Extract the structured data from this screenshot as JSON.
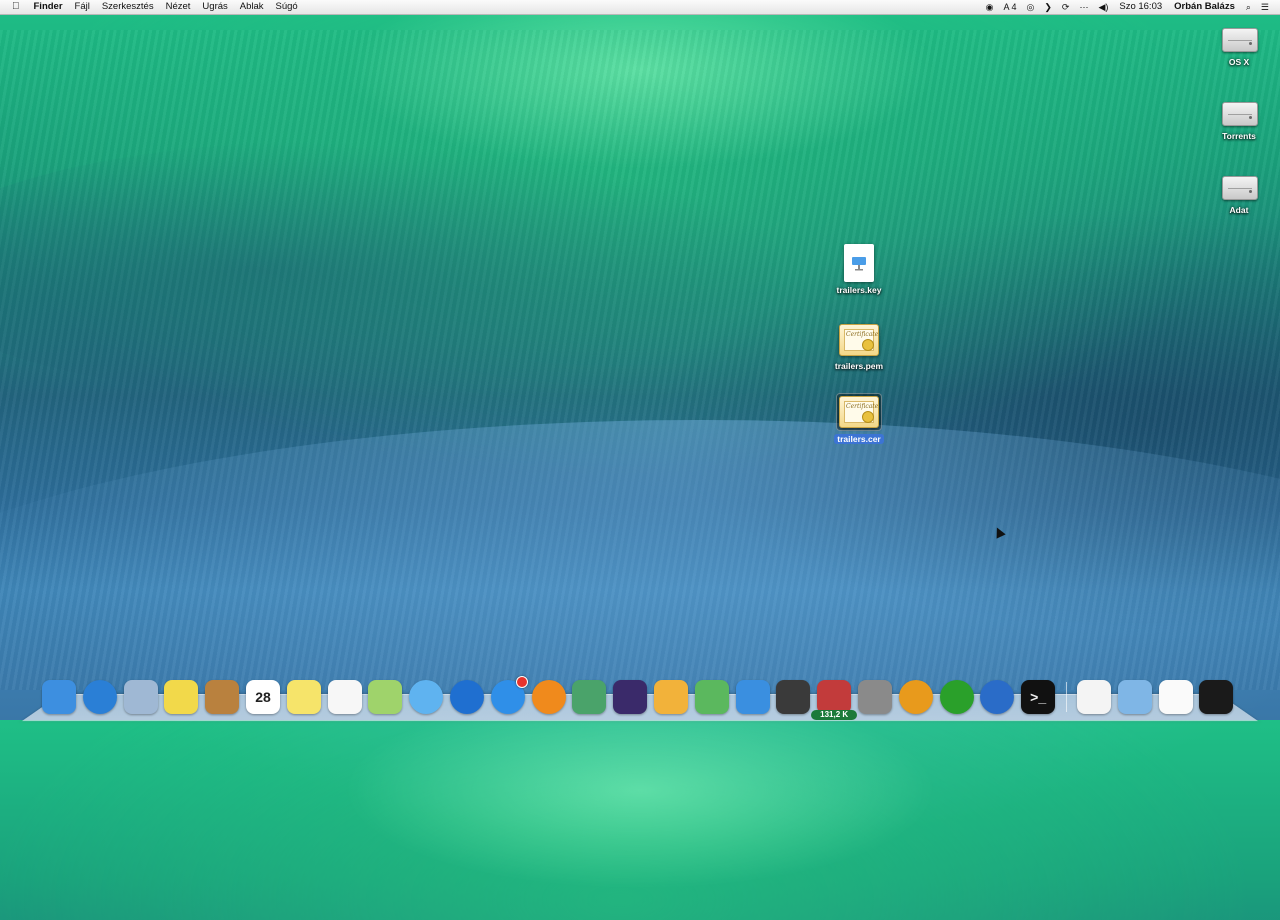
{
  "menubar": {
    "apple": "",
    "app_name": "Finder",
    "menus": [
      "Fájl",
      "Szerkesztés",
      "Nézet",
      "Ugrás",
      "Ablak",
      "Súgó"
    ],
    "status": {
      "record_icon": "◉",
      "display_icon": "A",
      "display_count": "4",
      "headphones_icon": "◎",
      "nav_icon": "❯",
      "sync_icon": "⟳",
      "dots_icon": "⋯",
      "volume_icon": "◀)",
      "clock": "Szo 16:03",
      "user": "Orbán Balázs",
      "search_icon": "⌕",
      "list_icon": "☰"
    }
  },
  "drives": [
    {
      "name": "OS X"
    },
    {
      "name": "Torrents"
    },
    {
      "name": "Adat"
    }
  ],
  "files": [
    {
      "name": "trailers.key",
      "kind": "keynote"
    },
    {
      "name": "trailers.pem",
      "kind": "certificate"
    },
    {
      "name": "trailers.cer",
      "kind": "certificate",
      "selected": true
    }
  ],
  "cert_script": "Certificate",
  "dock": {
    "apps": [
      {
        "name": "finder-icon",
        "bg": "#3d8fe0"
      },
      {
        "name": "safari-icon",
        "bg": "#2a7fd6"
      },
      {
        "name": "mail-icon",
        "bg": "#9fb8d4"
      },
      {
        "name": "stickies-icon",
        "bg": "#f2d94a"
      },
      {
        "name": "contacts-icon",
        "bg": "#b9813e"
      },
      {
        "name": "calendar-icon",
        "bg": "#ffffff",
        "text": "28"
      },
      {
        "name": "notes-icon",
        "bg": "#f6e46a"
      },
      {
        "name": "reminders-icon",
        "bg": "#f7f7f7"
      },
      {
        "name": "maps-icon",
        "bg": "#9fd36b"
      },
      {
        "name": "messages-icon",
        "bg": "#5fb3f0"
      },
      {
        "name": "itunes-icon",
        "bg": "#1f6fd0"
      },
      {
        "name": "app-store-icon",
        "bg": "#2f8fe8",
        "badge": true
      },
      {
        "name": "ibooks-icon",
        "bg": "#f08a1c"
      },
      {
        "name": "photo-booth-icon",
        "bg": "#4aa36a"
      },
      {
        "name": "imovie-icon",
        "bg": "#3a2a6a"
      },
      {
        "name": "pages-icon",
        "bg": "#f2b23a"
      },
      {
        "name": "numbers-icon",
        "bg": "#5bb85e"
      },
      {
        "name": "keynote-icon",
        "bg": "#3a8fe0"
      },
      {
        "name": "final-cut-icon",
        "bg": "#3a3a3a"
      },
      {
        "name": "downloader-icon",
        "bg": "#c23b3b",
        "label": "131,2 K"
      },
      {
        "name": "system-preferences-icon",
        "bg": "#8a8a8a"
      },
      {
        "name": "headphones-app-icon",
        "bg": "#e89a1c"
      },
      {
        "name": "adium-icon",
        "bg": "#2aa02a"
      },
      {
        "name": "quicktime-icon",
        "bg": "#2a6cc8"
      },
      {
        "name": "terminal-icon",
        "bg": "#111111",
        "text": ">_"
      }
    ],
    "stacks": [
      {
        "name": "document-stack-icon",
        "bg": "#f4f4f4"
      },
      {
        "name": "folder-stack-icon",
        "bg": "#7fb6e6"
      },
      {
        "name": "blank-stack-icon",
        "bg": "#fafafa"
      },
      {
        "name": "trash-icon",
        "bg": "#1a1a1a"
      }
    ]
  }
}
